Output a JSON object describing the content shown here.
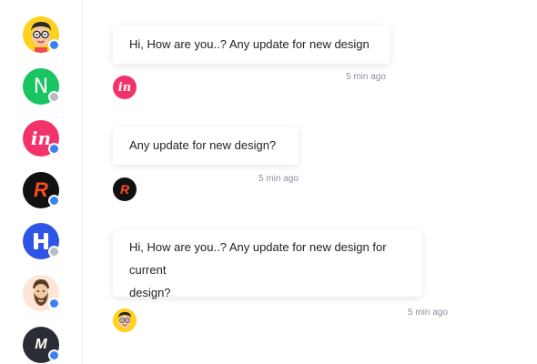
{
  "sidebar": {
    "contacts": [
      {
        "icon": "nerd-face-avatar-icon",
        "status": "online",
        "status_color": "#3b82f6"
      },
      {
        "icon": "n-letter-logo-icon",
        "status": "offline",
        "status_color": "#b8bcc4",
        "logo_text": "N",
        "bg": "#19c463"
      },
      {
        "icon": "invision-logo-icon",
        "status": "online",
        "status_color": "#3b82f6",
        "logo_text": "in",
        "bg": "#f2336b"
      },
      {
        "icon": "r-logo-icon",
        "status": "online",
        "status_color": "#3b82f6",
        "logo_text": "R",
        "bg": "#111111"
      },
      {
        "icon": "h-logo-icon",
        "status": "online",
        "status_color": "#b8bcc4",
        "logo_text": "H",
        "bg": "#2f55e6"
      },
      {
        "icon": "bearded-man-avatar-icon",
        "status": "online",
        "status_color": "#3b82f6"
      },
      {
        "icon": "m-logo-icon",
        "status": "online",
        "status_color": "#3b82f6",
        "logo_text": "M",
        "bg": "#2b2d35"
      }
    ]
  },
  "messages": [
    {
      "text": "Hi, How are you..? Any update for new design",
      "time": "5 min ago",
      "avatar": "invision-logo-icon",
      "avatar_text": "in"
    },
    {
      "text": "Any update for new design?",
      "time": "5 min ago",
      "avatar": "r-logo-icon",
      "avatar_text": "R"
    },
    {
      "text_line1": "Hi, How are you..? Any update for new design for current",
      "text_line2": "design?",
      "time": "5 min ago",
      "avatar": "nerd-face-avatar-icon"
    }
  ]
}
